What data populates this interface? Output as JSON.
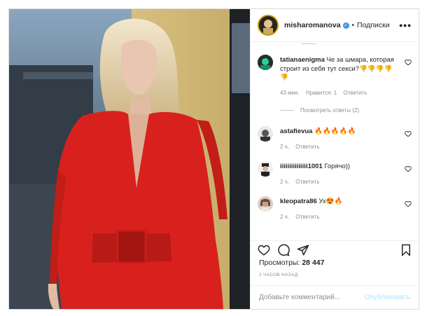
{
  "header": {
    "username": "misharomanova",
    "follow_label": "Подписки",
    "dot": "•",
    "more": "•••"
  },
  "comments": [
    {
      "user": "tatianaenigma",
      "text": "Че за шмара, которая строит из себя тут секси?👎👎👎👎👎",
      "time": "43 мин.",
      "likes": "Нравится: 1",
      "reply": "Ответить",
      "replies": "Посмотреть ответы (2)"
    },
    {
      "user": "astafievua",
      "text": "🔥🔥🔥🔥🔥",
      "time": "2 ч.",
      "reply": "Ответить"
    },
    {
      "user": "iiiiiiiiiiiiiii1001",
      "text": "Горячо))",
      "time": "2 ч.",
      "reply": "Ответить"
    },
    {
      "user": "kleopatra86",
      "text": "Ух😍🔥",
      "time": "2 ч.",
      "reply": "Ответить"
    }
  ],
  "views": {
    "label": "Просмотры:",
    "value": "28 447"
  },
  "timestamp": "2 ЧАСОВ НАЗАД",
  "add_comment": {
    "placeholder": "Добавьте комментарий...",
    "publish": "Опубликовать"
  },
  "colors": {
    "accent": "#3897f0",
    "publish_disabled": "#b2dffc",
    "dress": "#d8211d"
  },
  "icons": [
    "heart-icon",
    "comment-icon",
    "share-icon",
    "bookmark-icon",
    "verified-icon",
    "more-icon"
  ]
}
